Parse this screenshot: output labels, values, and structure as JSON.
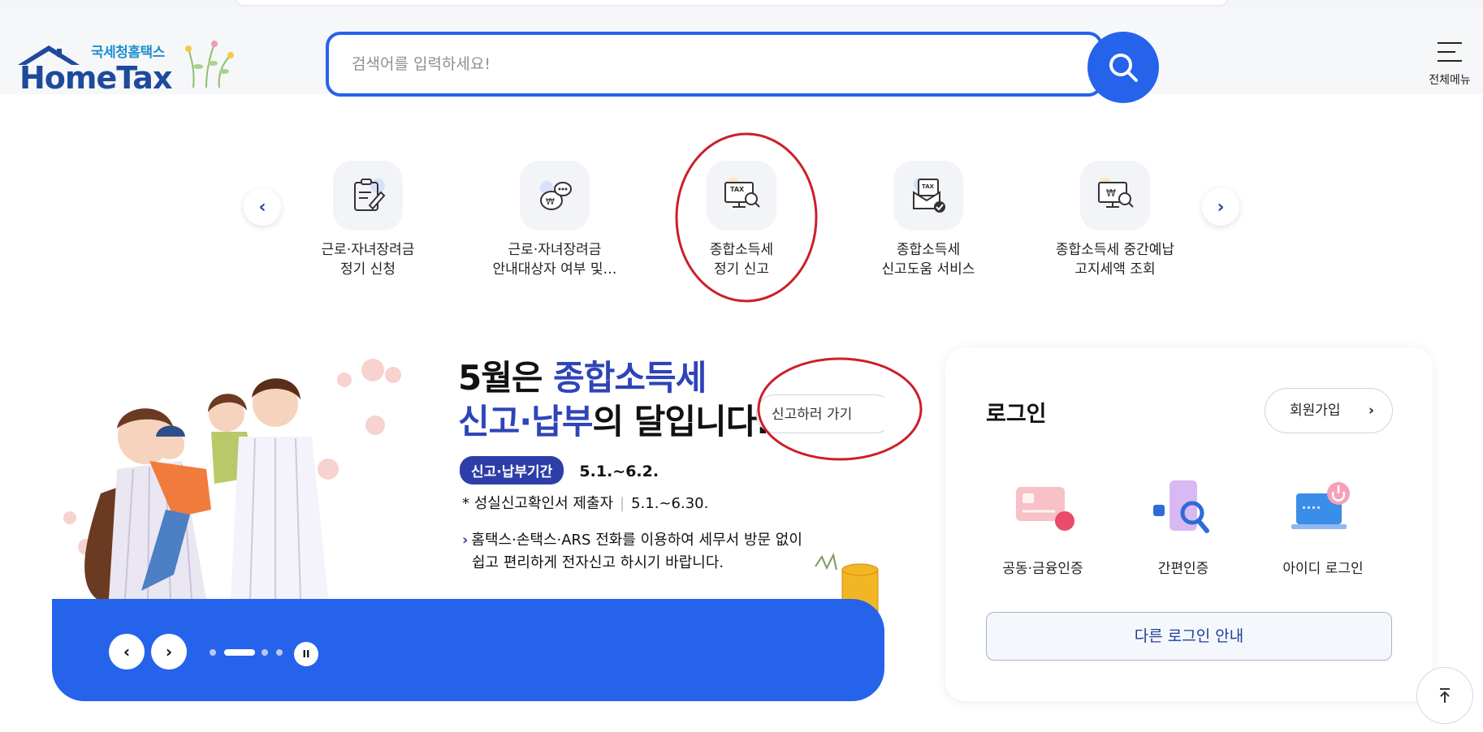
{
  "header": {
    "logo_sub": "국세청홈택스",
    "logo_main": "HomeTax",
    "search_placeholder": "검색어를 입력하세요!",
    "search_icon": "search-icon",
    "menu_label": "전체메뉴",
    "menu_icon": "hamburger-icon"
  },
  "quick_menu": {
    "prev_icon": "chevron-left-icon",
    "next_icon": "chevron-right-icon",
    "items": [
      {
        "label": "근로·자녀장려금\n정기 신청",
        "icon": "clipboard-pen-icon"
      },
      {
        "label": "근로·자녀장려금\n안내대상자 여부 및…",
        "icon": "chat-money-icon"
      },
      {
        "label": "종합소득세\n정기 신고",
        "icon": "tax-monitor-search-icon"
      },
      {
        "label": "종합소득세\n신고도움 서비스",
        "icon": "tax-envelope-check-icon"
      },
      {
        "label": "종합소득세 중간예납\n고지세액 조회",
        "icon": "won-monitor-search-icon"
      }
    ]
  },
  "banner": {
    "title_line1_prefix": "5월은 ",
    "title_line1_highlight": "종합소득세",
    "title_line2_highlight": "신고·납부",
    "title_line2_suffix": "의 달입니다.",
    "go_button": "신고하러 가기",
    "period_tag": "신고·납부기간",
    "period_value": "5.1.~6.2.",
    "confirm_label": "* 성실신고확인서 제출자",
    "confirm_value": "5.1.~6.30.",
    "desc_line1": "홈택스·손택스·ARS 전화를 이용하여 세무서 방문 없이",
    "desc_line2": "쉽고 편리하게 전자신고 하시기 바랍니다.",
    "prev_label": "‹",
    "next_label": "›",
    "pause_label": "II"
  },
  "login": {
    "title": "로그인",
    "join_label": "회원가입",
    "options": [
      {
        "label": "공동·금융인증",
        "icon": "certificate-card-icon"
      },
      {
        "label": "간편인증",
        "icon": "phone-search-icon"
      },
      {
        "label": "아이디 로그인",
        "icon": "laptop-power-icon"
      }
    ],
    "other_label": "다른 로그인 안내"
  },
  "to_top_icon": "arrow-up-icon",
  "colors": {
    "primary": "#2563eb",
    "navy": "#2e44b8",
    "annotation": "#cc1f2a"
  }
}
